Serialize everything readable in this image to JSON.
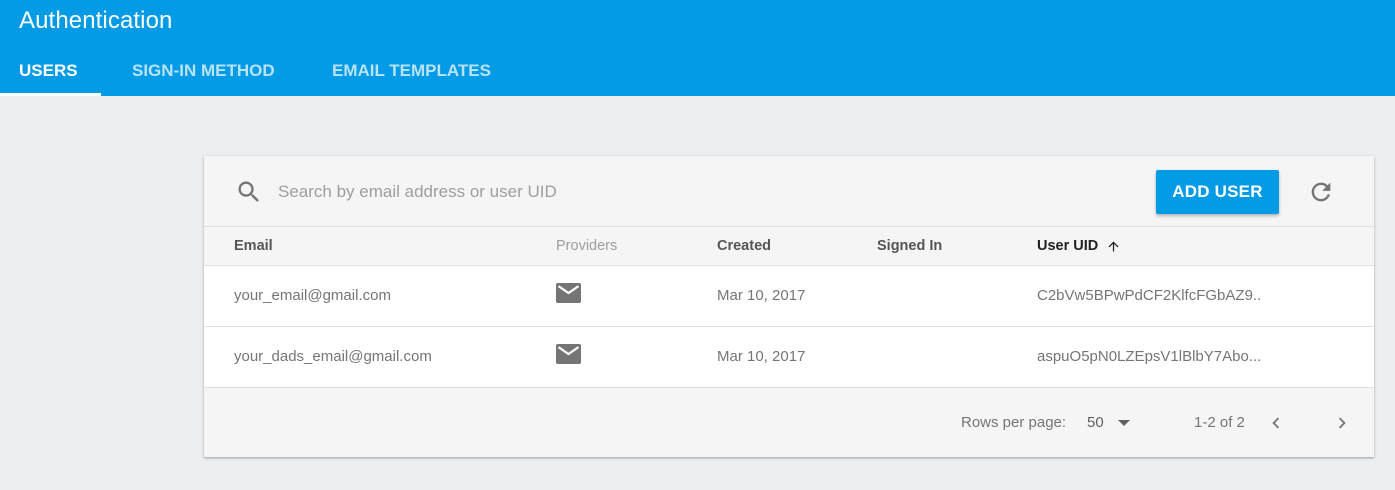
{
  "header": {
    "title": "Authentication",
    "bg_color": "#039be5",
    "tabs": [
      {
        "label": "USERS",
        "active": true
      },
      {
        "label": "SIGN-IN METHOD",
        "active": false
      },
      {
        "label": "EMAIL TEMPLATES",
        "active": false
      }
    ]
  },
  "toolbar": {
    "search_placeholder": "Search by email address or user UID",
    "search_value": "",
    "search_icon": "search-icon",
    "add_user_label": "ADD USER",
    "refresh_icon": "refresh-icon"
  },
  "table": {
    "columns": [
      "Email",
      "Providers",
      "Created",
      "Signed In",
      "User UID"
    ],
    "sorted_column": "User UID",
    "sort_direction": "ascending",
    "rows": [
      {
        "email": "your_email@gmail.com",
        "provider_icon": "mail-icon",
        "created": "Mar 10, 2017",
        "signed_in": "",
        "uid": "C2bVw5BPwPdCF2KlfcFGbAZ9.."
      },
      {
        "email": "your_dads_email@gmail.com",
        "provider_icon": "mail-icon",
        "created": "Mar 10, 2017",
        "signed_in": "",
        "uid": "aspuO5pN0LZEpsV1lBlbY7Abo..."
      }
    ]
  },
  "pagination": {
    "rows_per_page_label": "Rows per page:",
    "rows_per_page_value": "50",
    "range_label": "1-2 of 2"
  },
  "colors": {
    "accent": "#039be5",
    "page_bg": "#eceff1",
    "icon_gray": "#757575"
  }
}
